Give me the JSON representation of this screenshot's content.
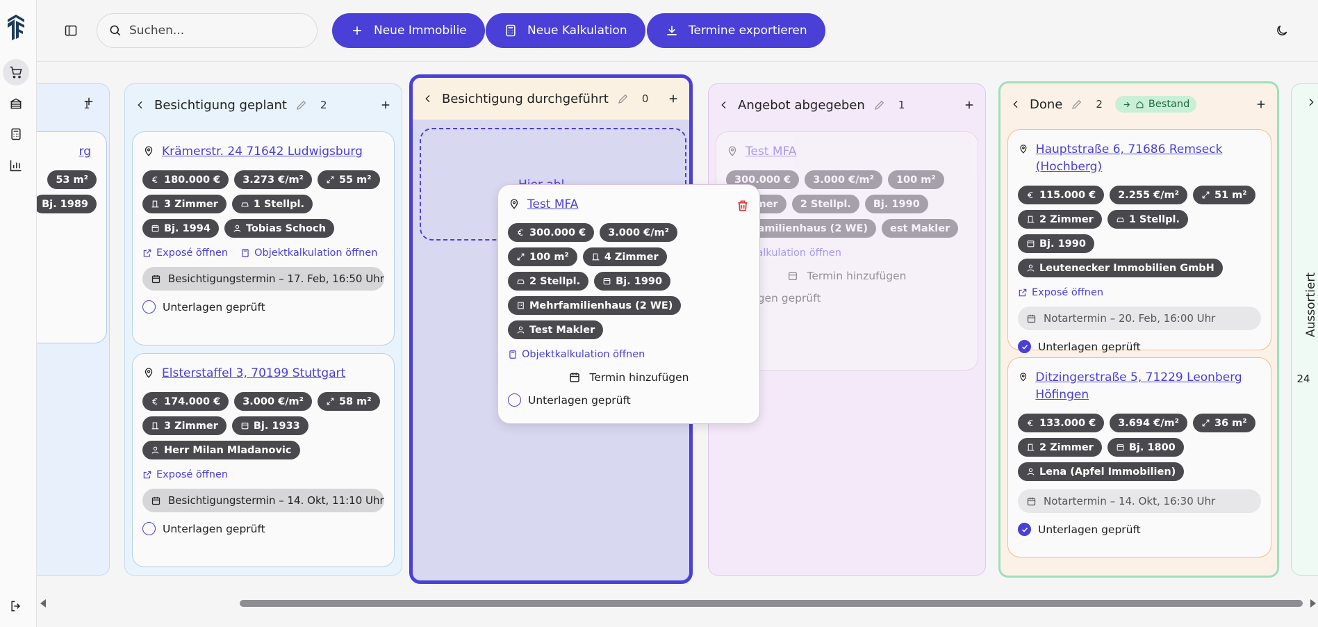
{
  "topbar": {
    "search_placeholder": "Suchen...",
    "new_property": "Neue Immobilie",
    "new_calculation": "Neue Kalkulation",
    "export_appointments": "Termine exportieren"
  },
  "columns": {
    "partial": {
      "count": "1",
      "card_addr": "rg",
      "chip_area": "53 m²",
      "chip_year": "Bj. 1989"
    },
    "planned": {
      "title": "Besichtigung geplant",
      "count": "2",
      "cards": [
        {
          "address": "Krämerstr. 24 71642 Ludwigsburg",
          "price": "180.000 €",
          "ppsqm": "3.273 €/m²",
          "area": "55 m²",
          "rooms": "3 Zimmer",
          "parking": "1 Stellpl.",
          "year": "Bj. 1994",
          "agent": "Tobias Schoch",
          "expose": "Exposé öffnen",
          "calc": "Objektkalkulation öffnen",
          "appointment": "Besichtigungstermin – 17. Feb, 16:50 Uhr",
          "docs": "Unterlagen geprüft"
        },
        {
          "address": "Elsterstaffel 3, 70199 Stuttgart",
          "price": "174.000 €",
          "ppsqm": "3.000 €/m²",
          "area": "58 m²",
          "rooms": "3 Zimmer",
          "year": "Bj. 1933",
          "agent": "Herr Milan Mladanovic",
          "expose": "Exposé öffnen",
          "appointment": "Besichtigungstermin – 14. Okt, 11:10 Uhr",
          "docs": "Unterlagen geprüft"
        }
      ]
    },
    "done_viewing": {
      "title": "Besichtigung durchgeführt",
      "count": "0",
      "drop_hint": "Hier abl"
    },
    "offer": {
      "title": "Angebot abgegeben",
      "count": "1",
      "card": {
        "address": "Test MFA",
        "price": "300.000 €",
        "ppsqm": "3.000 €/m²",
        "area": "100 m²",
        "rooms": "Zimmer",
        "parking": "2 Stellpl.",
        "year": "Bj. 1990",
        "type": "ehrfamilienhaus (2 WE)",
        "agent": "est Makler",
        "calc": "bjektkalkulation öffnen",
        "add_term": "Termin hinzufügen",
        "docs": "nterlagen geprüft"
      }
    },
    "done": {
      "title": "Done",
      "count": "2",
      "badge": "Bestand",
      "cards": [
        {
          "address": "Hauptstraße 6, 71686 Remseck (Hochberg)",
          "price": "115.000 €",
          "ppsqm": "2.255 €/m²",
          "area": "51 m²",
          "rooms": "2 Zimmer",
          "parking": "1 Stellpl.",
          "year": "Bj. 1990",
          "agent": "Leutenecker Immobilien GmbH",
          "expose": "Exposé öffnen",
          "appointment": "Notartermin – 20. Feb, 16:00 Uhr",
          "docs": "Unterlagen geprüft"
        },
        {
          "address": "Ditzingerstraße 5, 71229 Leonberg Höfingen",
          "price": "133.000 €",
          "ppsqm": "3.694 €/m²",
          "area": "36 m²",
          "rooms": "2 Zimmer",
          "year": "Bj. 1800",
          "agent": "Lena (Apfel Immobilien)",
          "appointment": "Notartermin – 14. Okt, 16:30 Uhr",
          "docs": "Unterlagen geprüft"
        }
      ]
    },
    "sorted": {
      "title": "Aussortiert",
      "count": "24"
    }
  },
  "drag_card": {
    "address": "Test MFA",
    "price": "300.000 €",
    "ppsqm": "3.000 €/m²",
    "area": "100 m²",
    "rooms": "4 Zimmer",
    "parking": "2 Stellpl.",
    "year": "Bj. 1990",
    "type": "Mehrfamilienhaus (2 WE)",
    "agent": "Test Makler",
    "calc": "Objektkalkulation öffnen",
    "add_term": "Termin hinzufügen",
    "docs": "Unterlagen geprüft"
  },
  "colors": {
    "primary": "#4a3fd6",
    "danger": "#d63a3a",
    "chip": "#4a4a4e"
  }
}
